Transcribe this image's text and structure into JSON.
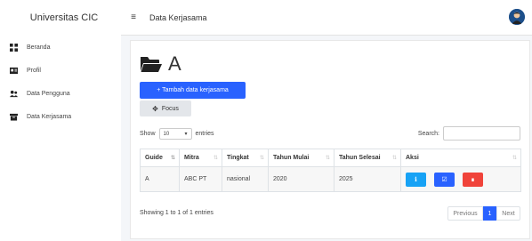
{
  "sidebar": {
    "brand": "Universitas CIC",
    "items": [
      {
        "label": "Beranda",
        "icon": "dashboard-icon"
      },
      {
        "label": "Profil",
        "icon": "id-card-icon"
      },
      {
        "label": "Data Pengguna",
        "icon": "users-icon"
      },
      {
        "label": "Data Kerjasama",
        "icon": "archive-icon"
      }
    ]
  },
  "topbar": {
    "menu_icon": "≡",
    "title": "Data Kerjasama"
  },
  "main": {
    "heading": "A",
    "add_button": "+ Tambah data kerjasama",
    "focus_icon": "✥",
    "focus_button": "Focus",
    "show_label": "Show",
    "entries_value": "10",
    "entries_label": "entries",
    "search_label": "Search:",
    "search_value": "",
    "table": {
      "columns": [
        "Guide",
        "Mitra",
        "Tingkat",
        "Tahun Mulai",
        "Tahun Selesai",
        "Aksi"
      ],
      "rows": [
        {
          "guide": "A",
          "mitra": "ABC PT",
          "tingkat": "nasional",
          "tahun_mulai": "2020",
          "tahun_selesai": "2025"
        }
      ],
      "action_icons": {
        "info": "ℹ",
        "edit": "☑",
        "delete": "∎"
      }
    },
    "info": "Showing 1 to 1 of 1 entries",
    "pagination": {
      "prev": "Previous",
      "current": "1",
      "next": "Next"
    }
  },
  "colors": {
    "primary": "#2962ff",
    "info": "#17a2f5",
    "danger": "#f0433a",
    "sidebar_bg": "#ffffff",
    "page_bg": "#f4f6f9"
  }
}
